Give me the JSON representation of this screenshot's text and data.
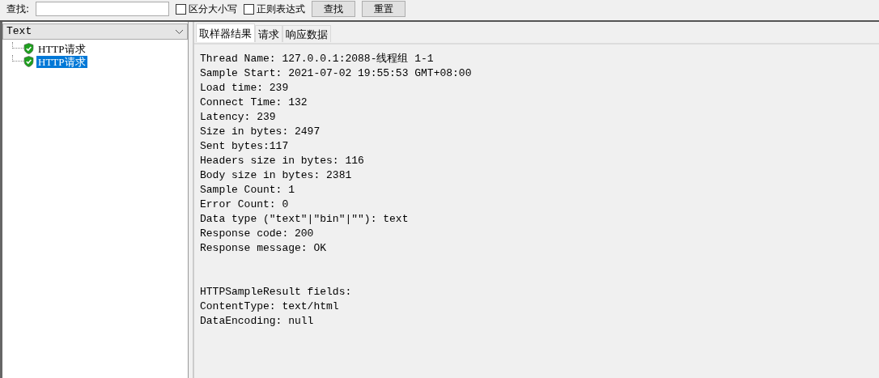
{
  "search_bar": {
    "label": "查找:",
    "options": [
      {
        "label": "区分大小写",
        "checked": false
      },
      {
        "label": "正则表达式",
        "checked": false
      }
    ],
    "buttons": [
      "查找",
      "重置"
    ]
  },
  "renderer": {
    "value": "Text"
  },
  "tree": [
    {
      "label": "HTTP请求",
      "passed": true,
      "selected": false
    },
    {
      "label": "HTTP请求",
      "passed": true,
      "selected": true
    }
  ],
  "tabs": [
    {
      "label": "取样器结果",
      "selected": true
    },
    {
      "label": "请求",
      "selected": false
    },
    {
      "label": "响应数据",
      "selected": false
    }
  ],
  "result_lines": [
    "Thread Name: 127.0.0.1:2088-线程组 1-1",
    "Sample Start: 2021-07-02 19:55:53 GMT+08:00",
    "Load time: 239",
    "Connect Time: 132",
    "Latency: 239",
    "Size in bytes: 2497",
    "Sent bytes:117",
    "Headers size in bytes: 116",
    "Body size in bytes: 2381",
    "Sample Count: 1",
    "Error Count: 0",
    "Data type (\"text\"|\"bin\"|\"\"): text",
    "Response code: 200",
    "Response message: OK"
  ],
  "field_lines": [
    "HTTPSampleResult fields:",
    "ContentType: text/html",
    "DataEncoding: null"
  ]
}
